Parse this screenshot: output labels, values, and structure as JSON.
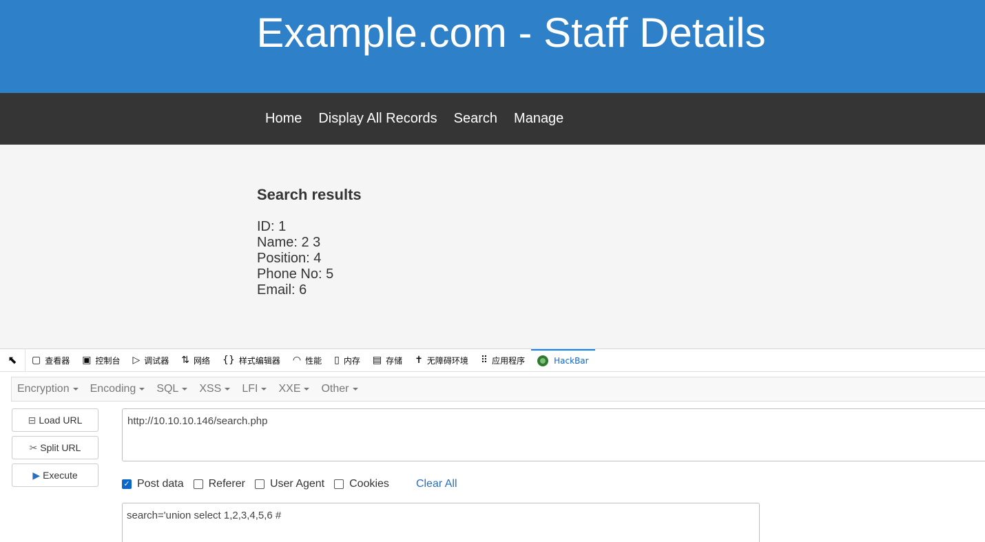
{
  "header": {
    "title": "Example.com - Staff Details"
  },
  "nav": {
    "items": [
      "Home",
      "Display All Records",
      "Search",
      "Manage"
    ]
  },
  "results": {
    "title": "Search results",
    "lines": [
      "ID: 1",
      "Name: 2 3",
      "Position: 4",
      "Phone No: 5",
      "Email: 6"
    ]
  },
  "devtools": {
    "tabs": [
      {
        "label": "查看器",
        "icon": "inspector-icon"
      },
      {
        "label": "控制台",
        "icon": "console-icon"
      },
      {
        "label": "调试器",
        "icon": "debugger-icon"
      },
      {
        "label": "网络",
        "icon": "network-icon"
      },
      {
        "label": "样式编辑器",
        "icon": "style-editor-icon"
      },
      {
        "label": "性能",
        "icon": "performance-icon"
      },
      {
        "label": "内存",
        "icon": "memory-icon"
      },
      {
        "label": "存储",
        "icon": "storage-icon"
      },
      {
        "label": "无障碍环境",
        "icon": "accessibility-icon"
      },
      {
        "label": "应用程序",
        "icon": "application-icon"
      },
      {
        "label": "HackBar",
        "icon": "hackbar-icon",
        "active": true
      }
    ]
  },
  "hackbar": {
    "menu": [
      "Encryption",
      "Encoding",
      "SQL",
      "XSS",
      "LFI",
      "XXE",
      "Other"
    ],
    "buttons": {
      "load": "Load URL",
      "split": "Split URL",
      "execute": "Execute"
    },
    "url": "http://10.10.10.146/search.php",
    "options": {
      "post": "Post data",
      "referer": "Referer",
      "useragent": "User Agent",
      "cookies": "Cookies",
      "post_checked": true
    },
    "clear_all": "Clear All",
    "post_data": "search='union select 1,2,3,4,5,6 #"
  },
  "colors": {
    "header": "#2e80c9",
    "nav": "#353535",
    "active_tab": "#0a67c9"
  }
}
